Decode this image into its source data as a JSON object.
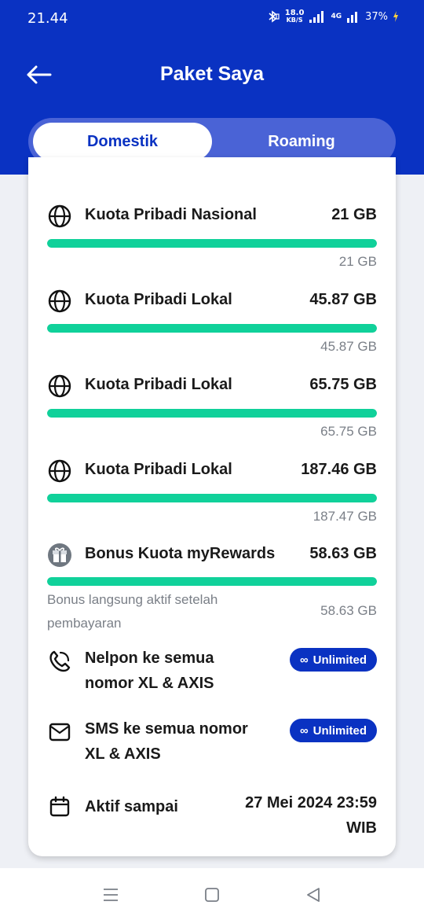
{
  "status_bar": {
    "time": "21.44",
    "net_speed_value": "18.0",
    "net_speed_unit": "KB/S",
    "network_label": "4G",
    "battery": "37%"
  },
  "header": {
    "title": "Paket Saya"
  },
  "tabs": [
    {
      "label": "Domestik",
      "active": true
    },
    {
      "label": "Roaming",
      "active": false
    }
  ],
  "quotas": [
    {
      "icon": "globe-icon",
      "label": "Kuota Pribadi Nasional",
      "value": "21 GB",
      "remaining": "21 GB",
      "fill_fraction": 1.0
    },
    {
      "icon": "globe-icon",
      "label": "Kuota Pribadi Lokal",
      "value": "45.87 GB",
      "remaining": "45.87 GB",
      "fill_fraction": 1.0
    },
    {
      "icon": "globe-icon",
      "label": "Kuota Pribadi Lokal",
      "value": "65.75 GB",
      "remaining": "65.75 GB",
      "fill_fraction": 1.0
    },
    {
      "icon": "globe-icon",
      "label": "Kuota Pribadi Lokal",
      "value": "187.46 GB",
      "remaining": "187.47 GB",
      "fill_fraction": 1.0
    },
    {
      "icon": "gift-icon",
      "label": "Bonus Kuota myRewards",
      "value": "58.63 GB",
      "remaining": "58.63 GB",
      "fill_fraction": 1.0,
      "note": "Bonus langsung aktif setelah pembayaran"
    }
  ],
  "benefits": [
    {
      "icon": "phone-icon",
      "label_line1": "Nelpon ke semua",
      "label_line2": "nomor XL & AXIS",
      "badge": "Unlimited"
    },
    {
      "icon": "envelope-icon",
      "label_line1": "SMS ke semua nomor",
      "label_line2": "XL & AXIS",
      "badge": "Unlimited"
    }
  ],
  "active_until": {
    "icon": "calendar-icon",
    "label": "Aktif sampai",
    "value_line1": "27 Mei 2024 23:59",
    "value_line2": "WIB"
  },
  "colors": {
    "brand_blue": "#0a32c2",
    "tab_track": "#4a63d6",
    "progress_green": "#10d19a"
  }
}
